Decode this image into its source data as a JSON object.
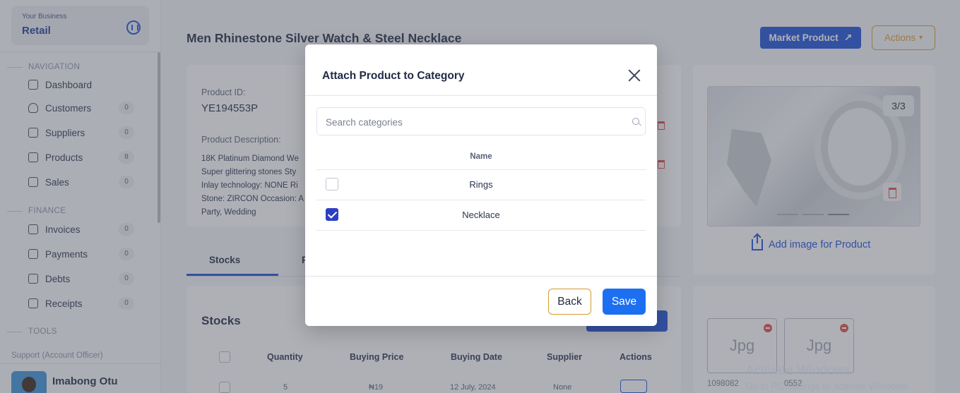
{
  "business": {
    "caption": "Your Business",
    "name": "Retail"
  },
  "sidebar": {
    "sections": {
      "navigation": "NAVIGATION",
      "finance": "FINANCE",
      "tools": "TOOLS"
    },
    "items": [
      {
        "label": "Dashboard",
        "icon": "dashboard-icon"
      },
      {
        "label": "Customers",
        "count": "0",
        "icon": "user-icon"
      },
      {
        "label": "Suppliers",
        "count": "0",
        "icon": "truck-icon"
      },
      {
        "label": "Products",
        "count": "8",
        "icon": "box-icon"
      },
      {
        "label": "Sales",
        "count": "0",
        "icon": "document-icon"
      },
      {
        "label": "Invoices",
        "count": "0",
        "icon": "invoice-icon"
      },
      {
        "label": "Payments",
        "count": "0",
        "icon": "cash-icon"
      },
      {
        "label": "Debts",
        "count": "0",
        "icon": "debt-icon"
      },
      {
        "label": "Receipts",
        "count": "0",
        "icon": "card-icon"
      }
    ],
    "support_label": "Support (Account Officer)",
    "officer_name": "Imabong Otu"
  },
  "page": {
    "title": "Men Rhinestone Silver Watch & Steel Necklace",
    "market_button": "Market Product",
    "actions_button": "Actions",
    "product_id_label": "Product ID:",
    "product_id": "YE194553P",
    "description_label": "Product Description:",
    "description": "18K Platinum Diamond We Super glittering stones Sty Inlay technology: NONE Ri Stone: ZIRCON Occasion: A Party, Wedding",
    "tabs": [
      "Stocks",
      "P"
    ],
    "stocks_title": "Stocks",
    "stock_table_headers": [
      "Quantity",
      "Buying Price",
      "Buying Date",
      "Supplier",
      "Actions"
    ],
    "stock_row": [
      "5",
      "₦19",
      "12 July, 2024",
      "None"
    ],
    "image_counter": "3/3",
    "add_image_label": "Add image for Product",
    "thumbnails": [
      {
        "label": "Jpg",
        "id": "1098082"
      },
      {
        "label": "Jpg",
        "id": "0552"
      }
    ]
  },
  "modal": {
    "title": "Attach Product to Category",
    "search_placeholder": "Search categories",
    "column_header": "Name",
    "categories": [
      {
        "name": "Rings",
        "checked": false
      },
      {
        "name": "Necklace",
        "checked": true
      }
    ],
    "back_label": "Back",
    "save_label": "Save"
  },
  "watermark": {
    "line1": "Activate Windows",
    "line2": "Go to PC settings to activate Windows."
  },
  "colors": {
    "primary": "#1d4fd8",
    "save_button": "#1d6ff2",
    "accent_orange": "#d99a30",
    "checkbox_checked": "#2b3fc4",
    "danger": "#e14b4b"
  }
}
